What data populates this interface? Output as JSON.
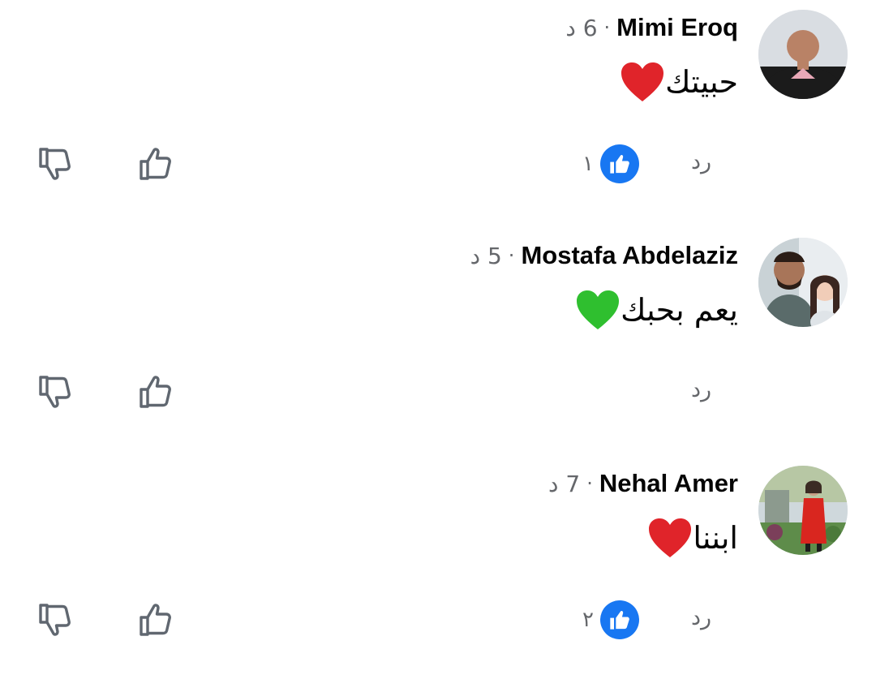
{
  "comments": [
    {
      "author": "Mimi Eroq",
      "time": "6 د",
      "separator": "·",
      "text": "حبيتك",
      "emoji": "heart-red",
      "heart_color": "#e0242a",
      "reply_label": "رد",
      "reaction_count": "١",
      "has_reactions": true
    },
    {
      "author": "Mostafa Abdelaziz",
      "time": "5 د",
      "separator": "·",
      "text": "يعم بحبك",
      "emoji": "heart-green",
      "heart_color": "#2fbf2f",
      "reply_label": "رد",
      "reaction_count": "",
      "has_reactions": false
    },
    {
      "author": "Nehal Amer",
      "time": "7 د",
      "separator": "·",
      "text": "ابننا",
      "emoji": "heart-red",
      "heart_color": "#e0242a",
      "reply_label": "رد",
      "reaction_count": "٢",
      "has_reactions": true
    }
  ],
  "icons": {
    "upvote": "thumbs-up-outline-icon",
    "downvote": "thumbs-down-outline-icon",
    "reaction": "like-badge-icon"
  },
  "colors": {
    "like_blue": "#1877f2",
    "meta_gray": "#65676b",
    "text": "#050505"
  }
}
